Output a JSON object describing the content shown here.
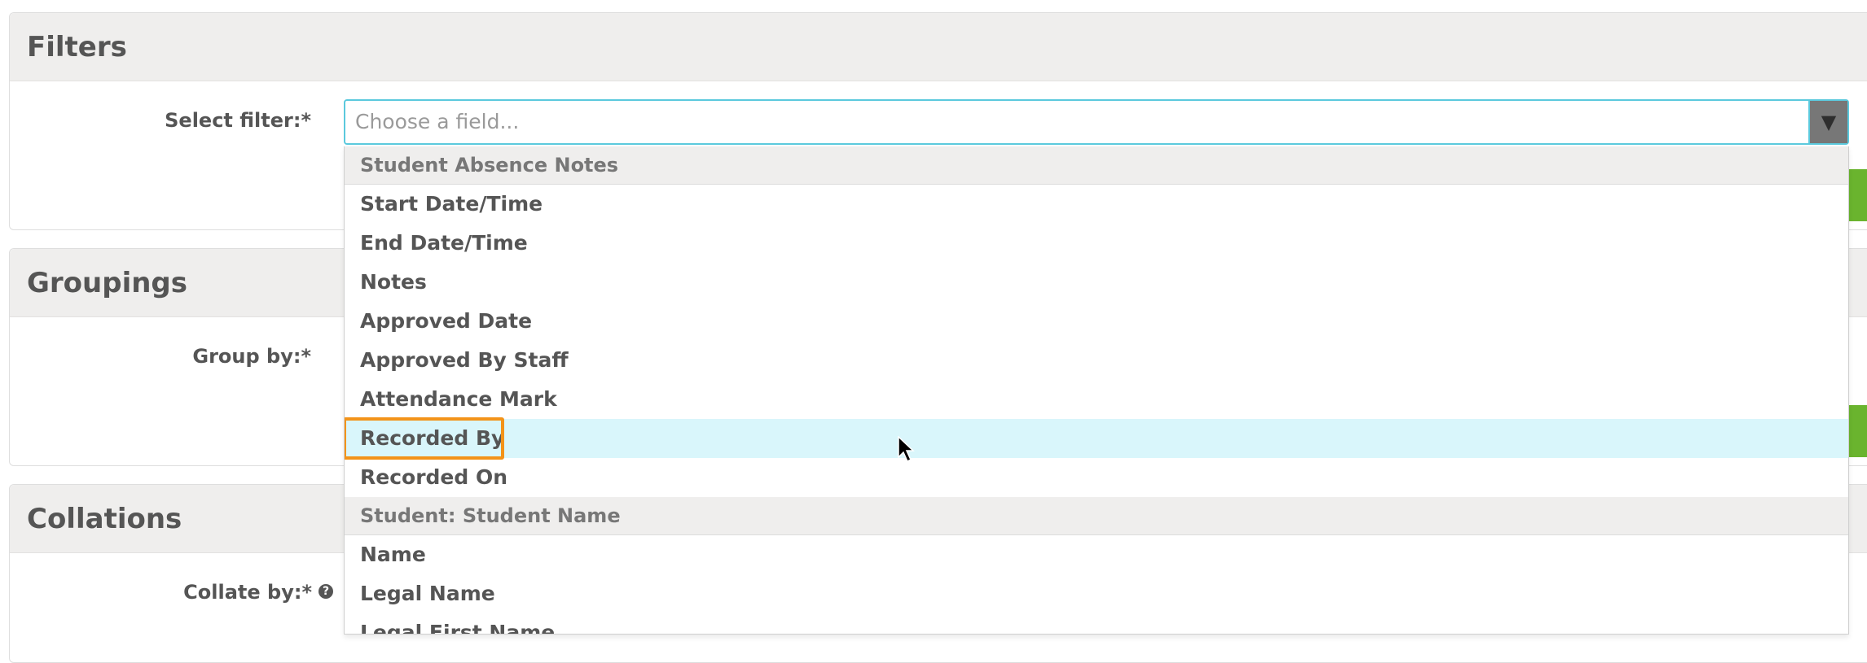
{
  "filters": {
    "title": "Filters",
    "label": "Select filter:*",
    "select_placeholder": "Choose a field..."
  },
  "groupings": {
    "title": "Groupings",
    "label": "Group by:*"
  },
  "collations": {
    "title": "Collations",
    "label": "Collate by:*",
    "help_icon": "?"
  },
  "dropdown": {
    "group1": "Student Absence Notes",
    "options1": [
      "Start Date/Time",
      "End Date/Time",
      "Notes",
      "Approved Date",
      "Approved By Staff",
      "Attendance Mark",
      "Recorded By",
      "Recorded On"
    ],
    "group2": "Student: Student Name",
    "options2": [
      "Name",
      "Legal Name",
      "Legal First Name"
    ],
    "highlighted": "Recorded By"
  },
  "colors": {
    "accent_border": "#5bc9dd",
    "highlight_row": "#d9f6fb",
    "annotation_box": "#f39319",
    "green_button": "#6ab42e"
  }
}
